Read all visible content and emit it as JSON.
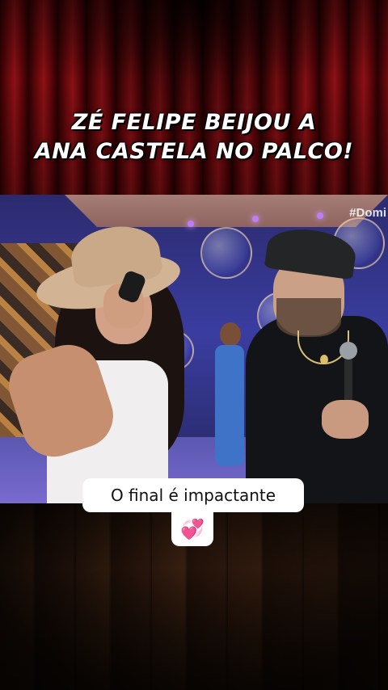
{
  "headline": {
    "line1": "ZÉ FELIPE BEIJOU A",
    "line2": "ANA CASTELA NO PALCO!"
  },
  "video": {
    "channel_tag": "#Domi"
  },
  "caption": {
    "text": "O final é impactante",
    "emoji": "💞"
  },
  "colors": {
    "curtain": "#a5141a",
    "caption_bg": "#ffffff",
    "heart": "#f15bb5"
  }
}
